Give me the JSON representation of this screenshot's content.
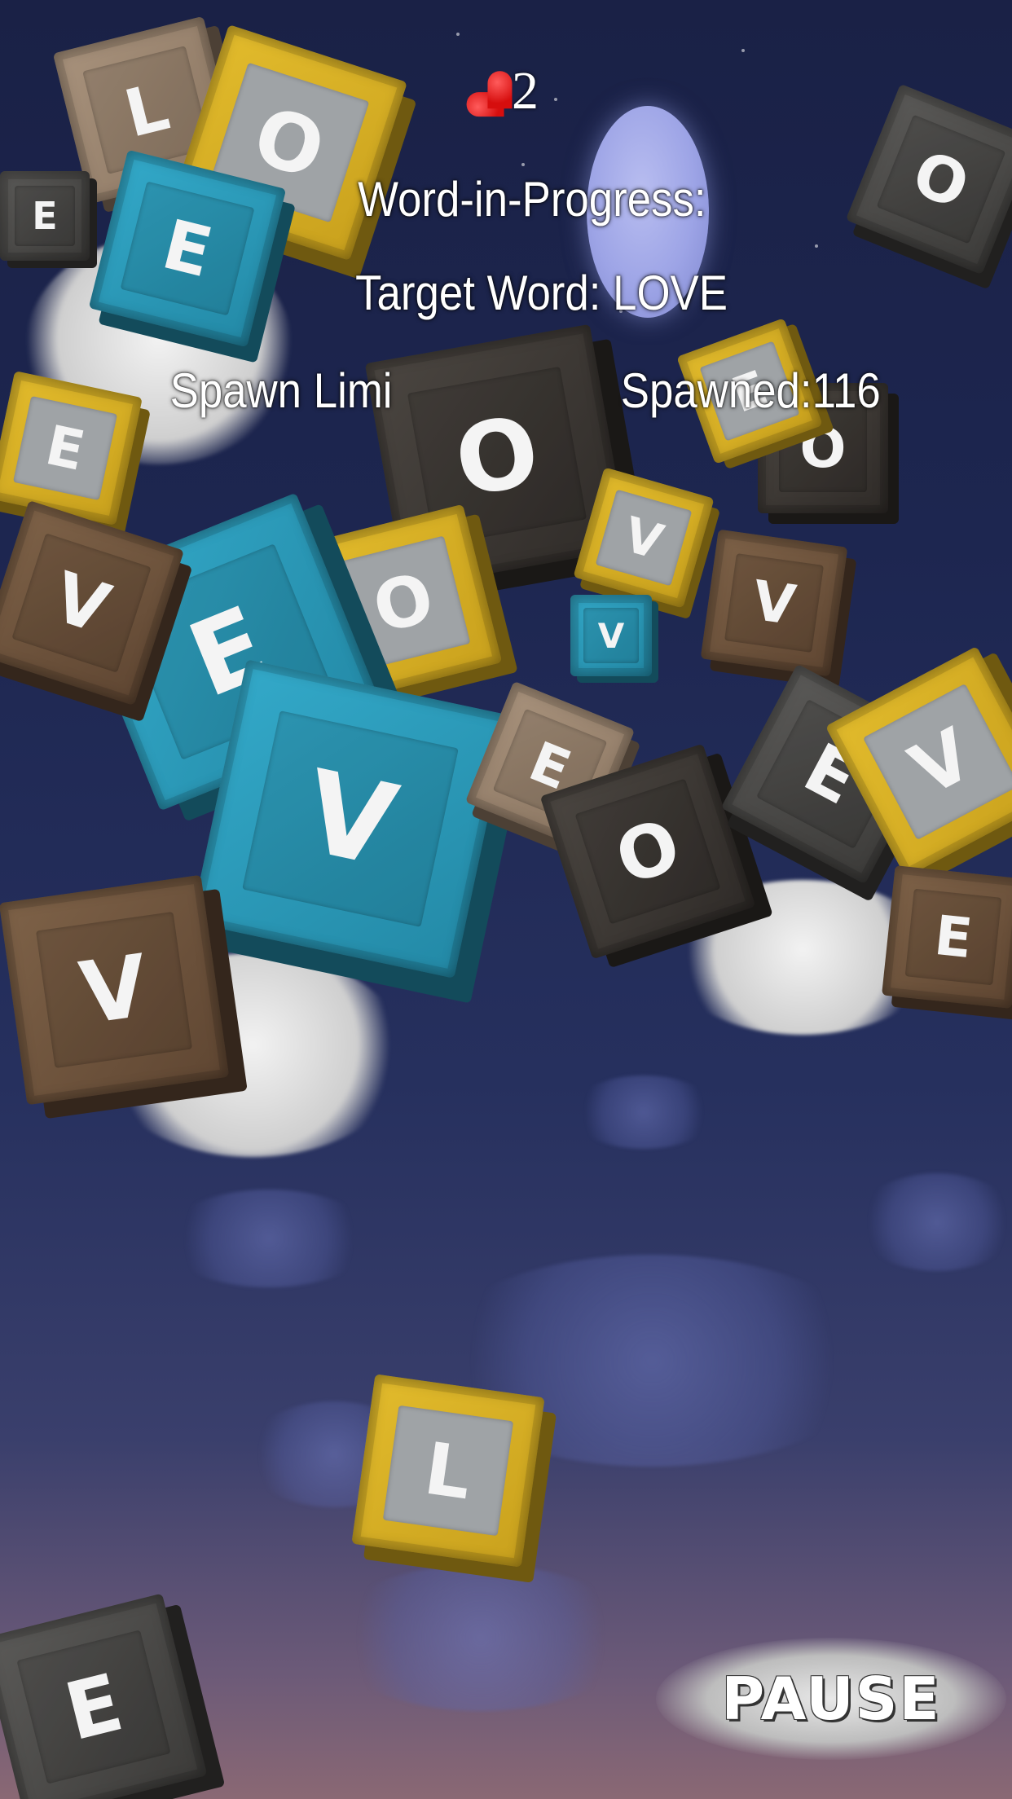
{
  "hud": {
    "lives": "2",
    "word_in_progress_label": "Word-in-Progress:",
    "target_word_label": "Target Word: LOVE",
    "spawn_limit_label": "Spawn Limi",
    "spawned_label": "Spawned:116"
  },
  "controls": {
    "pause_label": "PAUSE"
  },
  "cubes": [
    {
      "letter": "L",
      "color": "tan"
    },
    {
      "letter": "O",
      "color": "yellow"
    },
    {
      "letter": "E",
      "color": "teal"
    },
    {
      "letter": "O",
      "color": "dark"
    },
    {
      "letter": "E",
      "color": "grey"
    },
    {
      "letter": "O",
      "color": "dark"
    },
    {
      "letter": "O",
      "color": "grey"
    },
    {
      "letter": "E",
      "color": "yellow"
    },
    {
      "letter": "E",
      "color": "yellow"
    },
    {
      "letter": "V",
      "color": "yellow"
    },
    {
      "letter": "O",
      "color": "yellow"
    },
    {
      "letter": "V",
      "color": "brown"
    },
    {
      "letter": "V",
      "color": "teal"
    },
    {
      "letter": "E",
      "color": "teal"
    },
    {
      "letter": "V",
      "color": "teal"
    },
    {
      "letter": "V",
      "color": "brown"
    },
    {
      "letter": "E",
      "color": "tan"
    },
    {
      "letter": "O",
      "color": "dark"
    },
    {
      "letter": "E",
      "color": "grey"
    },
    {
      "letter": "V",
      "color": "yellow"
    },
    {
      "letter": "V",
      "color": "brown"
    },
    {
      "letter": "L",
      "color": "yellow"
    },
    {
      "letter": "E",
      "color": "grey"
    },
    {
      "letter": "E",
      "color": "brown"
    }
  ],
  "colors": {
    "sky_top": "#1a2146",
    "sky_bottom": "#8a6874",
    "heart": "#e01818",
    "hud_text": "#ffffff"
  }
}
